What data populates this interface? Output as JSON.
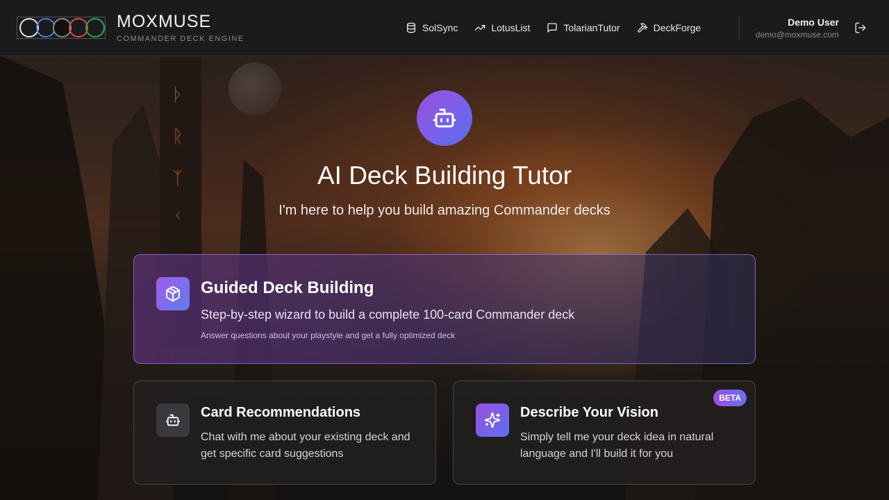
{
  "brand": {
    "title": "MOXMUSE",
    "subtitle": "COMMANDER DECK ENGINE",
    "mana_colors": [
      "#e8e8e8",
      "#4a7fe0",
      "#111111",
      "#e04848",
      "#2fa84f"
    ]
  },
  "nav": {
    "items": [
      {
        "label": "SolSync",
        "icon": "database-icon"
      },
      {
        "label": "LotusList",
        "icon": "trending-up-icon"
      },
      {
        "label": "TolarianTutor",
        "icon": "message-square-icon"
      },
      {
        "label": "DeckForge",
        "icon": "hammer-icon"
      }
    ]
  },
  "user": {
    "name": "Demo User",
    "email": "demo@moxmuse.com",
    "logout_icon": "log-out-icon"
  },
  "hero": {
    "icon": "bot-icon",
    "title": "AI Deck Building Tutor",
    "subtitle": "I'm here to help you build amazing Commander decks"
  },
  "cards": {
    "guided": {
      "icon": "package-icon",
      "title": "Guided Deck Building",
      "description": "Step-by-step wizard to build a complete 100-card Commander deck",
      "note": "Answer questions about your playstyle and get a fully optimized deck"
    },
    "recommendations": {
      "icon": "bot-icon",
      "title": "Card Recommendations",
      "description": "Chat with me about your existing deck and get specific card suggestions"
    },
    "vision": {
      "icon": "sparkles-icon",
      "title": "Describe Your Vision",
      "description": "Simply tell me your deck idea in natural language and I'll build it for you",
      "badge": "BETA"
    }
  },
  "colors": {
    "accent_purple": "#9b4fe0",
    "accent_blue": "#5a6ff0"
  }
}
